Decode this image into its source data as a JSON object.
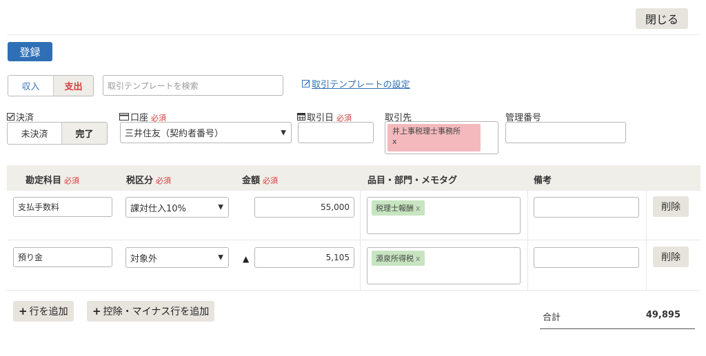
{
  "header": {
    "close_label": "閉じる"
  },
  "toolbar": {
    "register_label": "登録"
  },
  "type_toggle": {
    "income_label": "収入",
    "expense_label": "支出",
    "selected": "支出"
  },
  "template_search": {
    "placeholder": "取引テンプレートを検索",
    "settings_link": "取引テンプレートの設定"
  },
  "fields": {
    "settlement": {
      "label": "決済",
      "unsettled_label": "未決済",
      "done_label": "完了",
      "selected": "完了"
    },
    "account": {
      "label": "口座",
      "required": "必須",
      "value": "三井住友（契約者番号）"
    },
    "date": {
      "label": "取引日",
      "required": "必須",
      "value": ""
    },
    "partner": {
      "label": "取引先",
      "tag": "井上事税理士事務所",
      "remove": "x"
    },
    "ref_number": {
      "label": "管理番号",
      "value": ""
    }
  },
  "table": {
    "headers": {
      "account_item": "勘定科目",
      "tax": "税区分",
      "amount": "金額",
      "tags": "品目・部門・メモタグ",
      "note": "備考",
      "required": "必須"
    },
    "rows": [
      {
        "account_item": "支払手数料",
        "tax": "課対仕入10%",
        "minus": false,
        "amount": "55,000",
        "tag": "税理士報酬",
        "tag_remove": "x",
        "note": "",
        "delete_label": "削除"
      },
      {
        "account_item": "預り金",
        "tax": "対象外",
        "minus": true,
        "minus_symbol": "▲",
        "amount": "5,105",
        "tag": "源泉所得税",
        "tag_remove": "x",
        "note": "",
        "delete_label": "削除"
      }
    ]
  },
  "footer": {
    "add_row_label": "行を追加",
    "add_minus_row_label": "控除・マイナス行を追加",
    "total_label": "合計",
    "total_value": "49,895"
  },
  "icons": {
    "settlement": "checkbox-icon",
    "account": "bank-card-icon",
    "date": "calendar-icon",
    "link": "edit-icon",
    "select": "chevron-down-icon",
    "add": "plus-icon"
  },
  "colors": {
    "primary": "#2f6fb5",
    "required": "#d43d3d",
    "partner_tag": "#f4b9bd",
    "memo_tag": "#c7e5c0",
    "header_bg": "#f0eee9"
  }
}
